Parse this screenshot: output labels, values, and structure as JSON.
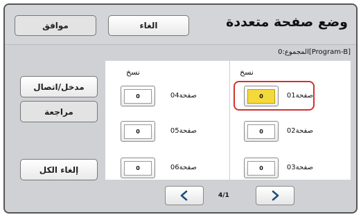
{
  "header": {
    "title": "وضع صفحة متعددة",
    "ok_label": "موافق",
    "cancel_label": "الغاء"
  },
  "subtitle": "[Program-B]المجموع:0",
  "sidebar": {
    "entry_label": "مدخل/اتصال",
    "review_label": "مراجعة",
    "clear_all_label": "إلغاء الكل"
  },
  "columns": {
    "left_header": "نسخ",
    "right_header": "نسخ"
  },
  "rows": {
    "p01": {
      "label": "صفحة01",
      "value": "0",
      "selected": true
    },
    "p02": {
      "label": "صفحة02",
      "value": "0"
    },
    "p03": {
      "label": "صفحة03",
      "value": "0"
    },
    "p04": {
      "label": "صفحة04",
      "value": "0"
    },
    "p05": {
      "label": "صفحة05",
      "value": "0"
    },
    "p06": {
      "label": "صفحة06",
      "value": "0"
    }
  },
  "pagination": {
    "indicator": "4/1",
    "prev_icon": "chevron-left-icon",
    "next_icon": "chevron-right-icon"
  },
  "colors": {
    "selected_fill": "#f4d93a",
    "highlight_outline": "#d0312d",
    "nav_arrow": "#1d4f7a"
  }
}
